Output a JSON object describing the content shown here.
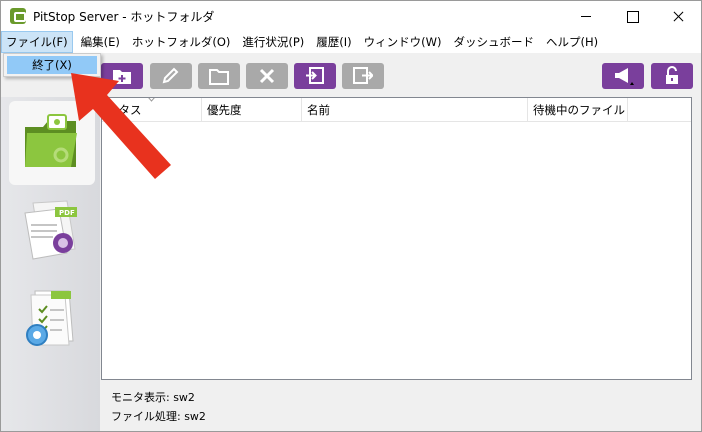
{
  "window": {
    "title": "PitStop Server - ホットフォルダ"
  },
  "menubar": {
    "items": [
      {
        "label": "ファイル(F)",
        "active": true
      },
      {
        "label": "編集(E)"
      },
      {
        "label": "ホットフォルダ(O)"
      },
      {
        "label": "進行状況(P)"
      },
      {
        "label": "履歴(I)"
      },
      {
        "label": "ウィンドウ(W)"
      },
      {
        "label": "ダッシュボード"
      },
      {
        "label": "ヘルプ(H)"
      }
    ]
  },
  "file_menu": {
    "items": [
      {
        "label": "終了(X)"
      }
    ]
  },
  "toolbar": {
    "buttons": [
      {
        "name": "new-folder-icon",
        "state": "enabled"
      },
      {
        "name": "edit-pencil-icon",
        "state": "disabled"
      },
      {
        "name": "folder-icon",
        "state": "disabled"
      },
      {
        "name": "delete-x-icon",
        "state": "disabled"
      },
      {
        "name": "import-icon",
        "state": "enabled"
      },
      {
        "name": "export-icon",
        "state": "disabled"
      },
      {
        "name": "megaphone-icon",
        "state": "enabled"
      },
      {
        "name": "unlock-icon",
        "state": "enabled"
      }
    ],
    "colors": {
      "enabled": "#7a3f9c",
      "disabled": "#a9a9a9"
    }
  },
  "sidebar": {
    "items": [
      {
        "name": "hot-folders-icon",
        "selected": true
      },
      {
        "name": "pdf-progress-icon",
        "selected": false
      },
      {
        "name": "history-checklist-icon",
        "selected": false
      }
    ]
  },
  "list": {
    "columns": [
      "ータス",
      "優先度",
      "名前",
      "待機中のファイル"
    ]
  },
  "status": {
    "monitor": "モニタ表示: sw2",
    "file_processing": "ファイル処理: sw2"
  },
  "annotation": {
    "arrow_color": "#e8321e"
  }
}
